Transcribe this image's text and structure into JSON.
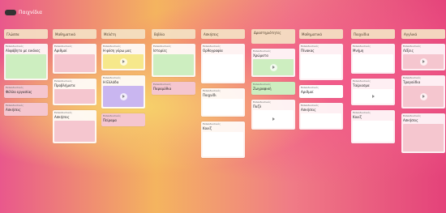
{
  "board": {
    "title": "Παιχνίδια",
    "colors": {
      "header_bg": "#f4e2c4",
      "post_green": "#cdeec0",
      "post_pink": "#f5c6cf",
      "post_yellow": "#f6e88b",
      "post_purple": "#c9b6f0",
      "post_white": "#ffffff"
    }
  },
  "columns": [
    {
      "title": "Γλώσσα",
      "posts": [
        {
          "meta": "Εκπαιδευτικός",
          "title": "Αλφάβητο με εικόνες",
          "thumb": "pic",
          "color": "green"
        },
        {
          "meta": "Εκπαιδευτικός",
          "title": "Φύλλο εργασίας",
          "thumb": "none",
          "color": "pink"
        },
        {
          "meta": "Εκπαιδευτικός",
          "title": "Ασκήσεις",
          "thumb": "none",
          "color": "pink"
        }
      ]
    },
    {
      "title": "Μαθηματικά",
      "posts": [
        {
          "meta": "Εκπαιδευτικός",
          "title": "Αριθμοί",
          "thumb": "pic",
          "color": "pink"
        },
        {
          "meta": "Εκπαιδευτικός",
          "title": "Προβλήματα",
          "thumb": "pic",
          "color": "pink"
        },
        {
          "meta": "Εκπαιδευτικός",
          "title": "Ασκήσεις",
          "thumb": "pic",
          "color": "pink"
        }
      ]
    },
    {
      "title": "Μελέτη",
      "posts": [
        {
          "meta": "Εκπαιδευτικός",
          "title": "Η φύση γύρω μας",
          "thumb": "play",
          "color": "yellow"
        },
        {
          "meta": "Εκπαιδευτικός",
          "title": "Η Ελλάδα",
          "thumb": "play",
          "color": "purple"
        },
        {
          "meta": "Εκπαιδευτικός",
          "title": "Πείραμα",
          "thumb": "none",
          "color": "pink"
        }
      ]
    },
    {
      "title": "Βιβλία",
      "posts": [
        {
          "meta": "Εκπαιδευτικός",
          "title": "Ιστορίες",
          "thumb": "pic",
          "color": "green"
        },
        {
          "meta": "Εκπαιδευτικός",
          "title": "Παραμύθια",
          "thumb": "none",
          "color": "pink"
        }
      ]
    },
    {
      "title": "Ασκήσεις",
      "posts": [
        {
          "meta": "Εκπαιδευτικός",
          "title": "Ορθογραφία",
          "thumb": "pic",
          "color": "white"
        },
        {
          "meta": "Εκπαιδευτικός",
          "title": "Παιχνίδι",
          "thumb": "pic",
          "color": "white"
        },
        {
          "meta": "Εκπαιδευτικός",
          "title": "Κουίζ",
          "thumb": "pic",
          "color": "white"
        }
      ]
    },
    {
      "title": "Δραστηριότητες",
      "posts": [
        {
          "meta": "Εκπαιδευτικός",
          "title": "Χρώματα",
          "thumb": "play",
          "color": "green"
        },
        {
          "meta": "Εκπαιδευτικός",
          "title": "Ζωγραφική",
          "thumb": "none",
          "color": "green"
        },
        {
          "meta": "Εκπαιδευτικός",
          "title": "Παζλ",
          "thumb": "play",
          "color": "white"
        }
      ]
    },
    {
      "title": "Μαθηματικά",
      "posts": [
        {
          "meta": "Εκπαιδευτικός",
          "title": "Πίνακας",
          "thumb": "pic",
          "color": "white"
        },
        {
          "meta": "Εκπαιδευτικός",
          "title": "Αριθμοί",
          "thumb": "none",
          "color": "white"
        },
        {
          "meta": "Εκπαιδευτικός",
          "title": "Ασκήσεις",
          "thumb": "pic",
          "color": "white"
        }
      ]
    },
    {
      "title": "Παιχνίδια",
      "posts": [
        {
          "meta": "Εκπαιδευτικός",
          "title": "Μνήμη",
          "thumb": "pic",
          "color": "white"
        },
        {
          "meta": "Εκπαιδευτικός",
          "title": "Ταίριασμα",
          "thumb": "play",
          "color": "white"
        },
        {
          "meta": "Εκπαιδευτικός",
          "title": "Κουίζ",
          "thumb": "pic",
          "color": "white"
        }
      ]
    },
    {
      "title": "Αγγλικά",
      "posts": [
        {
          "meta": "Εκπαιδευτικός",
          "title": "Λέξεις",
          "thumb": "play",
          "color": "pink"
        },
        {
          "meta": "Εκπαιδευτικός",
          "title": "Τραγούδια",
          "thumb": "play",
          "color": "pink"
        },
        {
          "meta": "Εκπαιδευτικός",
          "title": "Ασκήσεις",
          "thumb": "pic",
          "color": "pink"
        }
      ]
    }
  ]
}
